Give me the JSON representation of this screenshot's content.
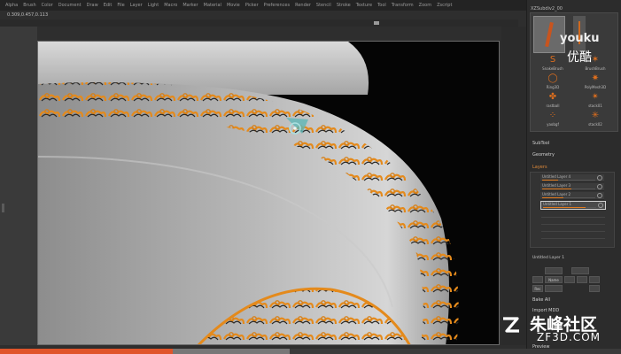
{
  "menu": [
    "Alpha",
    "Brush",
    "Color",
    "Document",
    "Draw",
    "Edit",
    "File",
    "Layer",
    "Light",
    "Macro",
    "Marker",
    "Material",
    "Movie",
    "Picker",
    "Preferences",
    "Render",
    "Stencil",
    "Stroke",
    "Texture",
    "Tool",
    "Transform",
    "Zoom",
    "Zscript"
  ],
  "coords": "0.309,0.457,0.113",
  "panel": {
    "brush_header": "XZSubdiv2_00",
    "brushes": [
      {
        "label": "SnakeBrush",
        "icon": "snake-hook-icon",
        "glyph": "S"
      },
      {
        "label": "BrushBrush",
        "icon": "brush-star-icon",
        "glyph": "✶"
      },
      {
        "label": "Ring3D",
        "icon": "ring-icon",
        "glyph": "◯"
      },
      {
        "label": "PolyMesh3D",
        "icon": "star-icon",
        "glyph": "✷"
      },
      {
        "label": "rastball",
        "icon": "blob-icon",
        "glyph": "✤"
      },
      {
        "label": "stack01",
        "icon": "splat-icon",
        "glyph": "✴"
      },
      {
        "label": "yaobgf",
        "icon": "dots-icon",
        "glyph": "⁘"
      },
      {
        "label": "stack02",
        "icon": "cluster-icon",
        "glyph": "✳"
      }
    ],
    "subtool_label": "SubTool",
    "geometry_label": "Geometry",
    "layers_label": "Layers",
    "layers": [
      {
        "name": "Untitled Layer 4",
        "strength": 0.3
      },
      {
        "name": "Untitled Layer 3",
        "strength": 0.55
      },
      {
        "name": "Untitled Layer 2",
        "strength": 0.4
      },
      {
        "name": "Untitled Layer 1",
        "strength": 0.8,
        "selected": true
      }
    ],
    "active_layer": "Untitled Layer 1",
    "buttons": [
      "Name",
      "Rec",
      "Bake All",
      "Import MDD",
      "Preview"
    ],
    "bake_label": "Bake All",
    "import_label": "Import MDD",
    "preview_label": "Preview"
  },
  "watermark": {
    "top_en": "youku",
    "top_cn": "优酷",
    "bottom_cn": "朱峰社区",
    "bottom_en": "ZF3D.COM"
  },
  "video": {
    "progress": 0.41
  },
  "colors": {
    "accent": "#e07a1e",
    "canvas_bg": "#000000",
    "model": "#b8b8b8",
    "progress": "#e0542a"
  }
}
